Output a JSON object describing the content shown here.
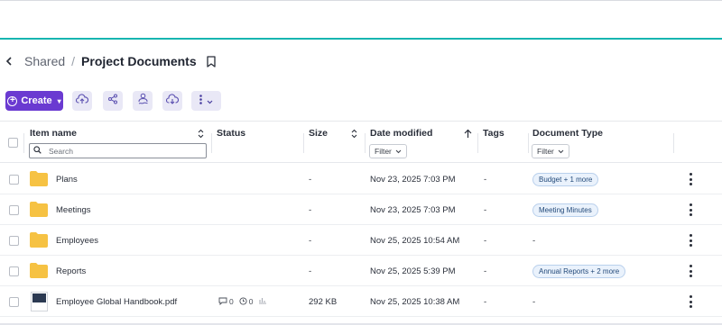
{
  "breadcrumb": {
    "parent": "Shared",
    "separator": "/",
    "current": "Project Documents"
  },
  "toolbar": {
    "create_label": "Create"
  },
  "columns": {
    "item_name": "Item name",
    "status": "Status",
    "size": "Size",
    "date_modified": "Date modified",
    "tags": "Tags",
    "document_type": "Document Type"
  },
  "search": {
    "placeholder": "Search"
  },
  "filters": {
    "date_filter": "Filter",
    "doctype_filter": "Filter"
  },
  "rows": [
    {
      "name": "Plans",
      "kind": "folder",
      "size": "-",
      "date": "Nov 23, 2025 7:03 PM",
      "tags": "-",
      "doc_type": "Budget + 1 more"
    },
    {
      "name": "Meetings",
      "kind": "folder",
      "size": "-",
      "date": "Nov 23, 2025 7:03 PM",
      "tags": "-",
      "doc_type": "Meeting Minutes"
    },
    {
      "name": "Employees",
      "kind": "folder",
      "size": "-",
      "date": "Nov 25, 2025 10:54 AM",
      "tags": "-",
      "doc_type": "-"
    },
    {
      "name": "Reports",
      "kind": "folder",
      "size": "-",
      "date": "Nov 25, 2025 5:39 PM",
      "tags": "-",
      "doc_type": "Annual Reports + 2 more"
    },
    {
      "name": "Employee Global Handbook.pdf",
      "kind": "file",
      "comments": "0",
      "views": "0",
      "size": "292 KB",
      "date": "Nov 25, 2025 10:38 AM",
      "tags": "-",
      "doc_type": "-"
    }
  ],
  "colors": {
    "accent": "#6a3ad1",
    "teal_line": "#17b5b0",
    "folder": "#f6c243",
    "badge_bg": "#eaf2fc"
  }
}
